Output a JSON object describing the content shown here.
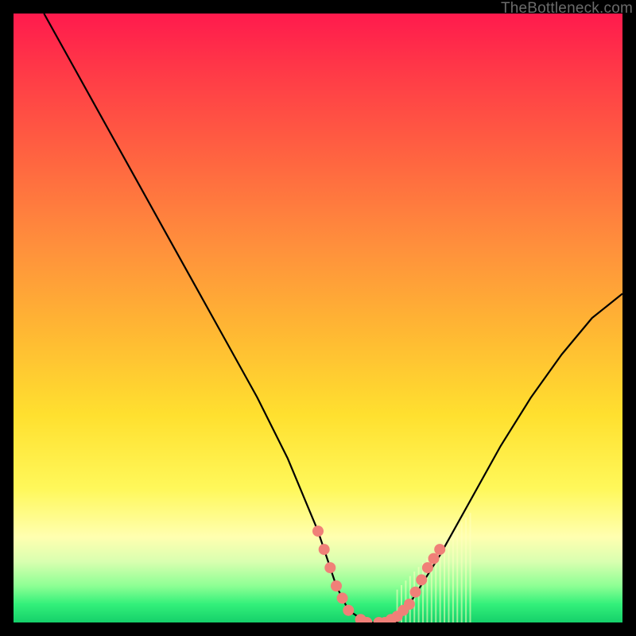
{
  "watermark": "TheBottleneck.com",
  "chart_data": {
    "type": "line",
    "title": "",
    "xlabel": "",
    "ylabel": "",
    "xlim": [
      0,
      100
    ],
    "ylim": [
      0,
      100
    ],
    "series": [
      {
        "name": "bottleneck-curve",
        "x": [
          5,
          10,
          15,
          20,
          25,
          30,
          35,
          40,
          45,
          50,
          53,
          55,
          58,
          60,
          63,
          65,
          70,
          75,
          80,
          85,
          90,
          95,
          100
        ],
        "y": [
          100,
          91,
          82,
          73,
          64,
          55,
          46,
          37,
          27,
          15,
          6,
          2,
          0,
          0,
          0,
          3,
          11,
          20,
          29,
          37,
          44,
          50,
          54
        ]
      }
    ],
    "markers": {
      "name": "highlight-dots",
      "color": "#f08078",
      "x": [
        50,
        51,
        52,
        53,
        54,
        55,
        57,
        58,
        60,
        61,
        62,
        63,
        64,
        65,
        66,
        67,
        68,
        69,
        70
      ],
      "y": [
        15,
        12,
        9,
        6,
        4,
        2,
        0.5,
        0,
        0,
        0,
        0.5,
        1,
        2,
        3,
        5,
        7,
        9,
        10.5,
        12
      ]
    },
    "glow": {
      "name": "bottom-glow",
      "color": "#ffffc0",
      "x_start": 63,
      "x_end": 75,
      "y_top": 18
    },
    "gradient_stops": [
      {
        "pos": 0,
        "color": "#ff1a4d"
      },
      {
        "pos": 25,
        "color": "#ff6840"
      },
      {
        "pos": 52,
        "color": "#ffb733"
      },
      {
        "pos": 78,
        "color": "#fff85a"
      },
      {
        "pos": 94,
        "color": "#8dff94"
      },
      {
        "pos": 100,
        "color": "#15d06a"
      }
    ]
  }
}
